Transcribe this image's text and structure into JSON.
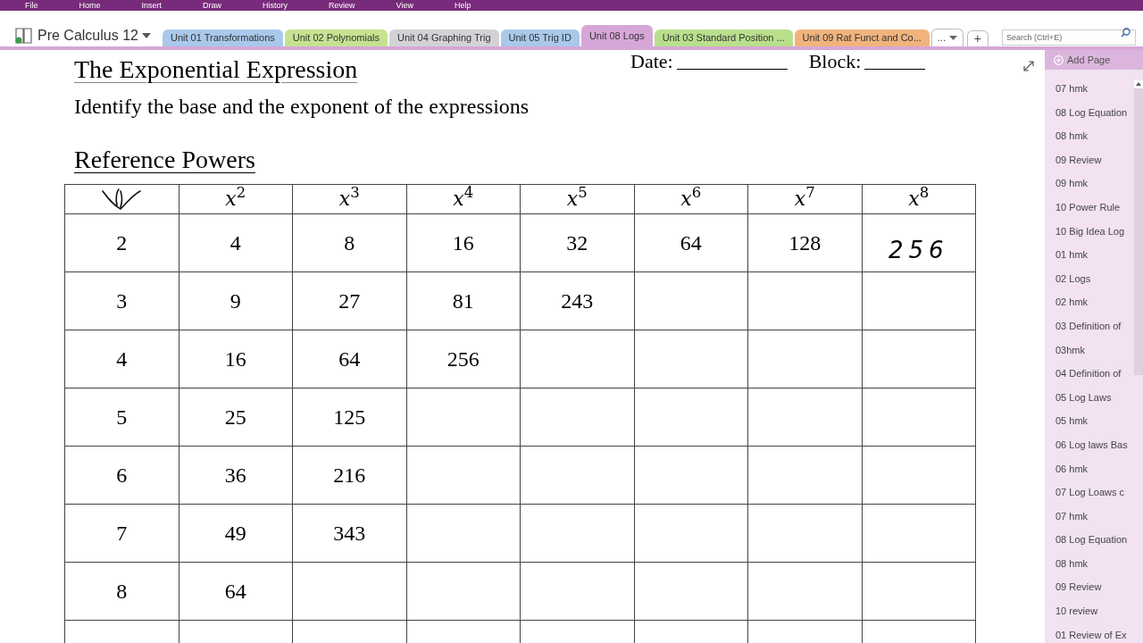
{
  "menu": [
    "File",
    "Home",
    "Insert",
    "Draw",
    "History",
    "Review",
    "View",
    "Help"
  ],
  "notebook": {
    "title": "Pre Calculus 12"
  },
  "tabs": [
    {
      "label": "Unit 01 Transformations",
      "color": "#a9c8ea",
      "selected": false
    },
    {
      "label": "Unit 02 Polynomials",
      "color": "#c6e290",
      "selected": false
    },
    {
      "label": "Unit 04 Graphing Trig",
      "color": "#d2d2d6",
      "selected": false
    },
    {
      "label": "Unit 05 Trig ID",
      "color": "#a9c8ea",
      "selected": false
    },
    {
      "label": "Unit 08 Logs",
      "color": "#d7a6d8",
      "selected": true
    },
    {
      "label": "Unit 03 Standard Position ...",
      "color": "#b9df8c",
      "selected": false
    },
    {
      "label": "Unit 09 Rat Funct and Co...",
      "color": "#f1b37c",
      "selected": false
    }
  ],
  "more_tabs": "...",
  "add_tab": "+",
  "search": {
    "placeholder": "Search (Ctrl+E)"
  },
  "page": {
    "title": "The Exponential Expression",
    "date_label": "Date:",
    "block_label": "Block:",
    "instruction": "Identify the base and the exponent of the expressions",
    "section": "Reference Powers",
    "table": {
      "columns": [
        "",
        "*x*$^{2}$",
        "*x*$^{3}$",
        "*x*$^{4}$",
        "*x*$^{5}$",
        "*x*$^{6}$",
        "*x*$^{7}$",
        "*x*$^{8}$"
      ],
      "rows": [
        [
          {
            "text": "2",
            "kind": "typed"
          },
          {
            "text": "4",
            "kind": "typed"
          },
          {
            "text": "8",
            "kind": "typed"
          },
          {
            "text": "16",
            "kind": "typed"
          },
          {
            "text": "32",
            "kind": "typed"
          },
          {
            "text": "64",
            "kind": "typed"
          },
          {
            "text": "128",
            "kind": "typed"
          },
          {
            "text": "256",
            "kind": "handwritten"
          }
        ],
        [
          {
            "text": "3",
            "kind": "typed"
          },
          {
            "text": "9",
            "kind": "typed"
          },
          {
            "text": "27",
            "kind": "typed"
          },
          {
            "text": "81",
            "kind": "typed"
          },
          {
            "text": "243",
            "kind": "typed"
          }
        ],
        [
          {
            "text": "4",
            "kind": "typed"
          },
          {
            "text": "16",
            "kind": "typed"
          },
          {
            "text": "64",
            "kind": "typed"
          },
          {
            "text": "256",
            "kind": "typed"
          }
        ],
        [
          {
            "text": "5",
            "kind": "typed"
          },
          {
            "text": "25",
            "kind": "typed"
          },
          {
            "text": "125",
            "kind": "typed"
          }
        ],
        [
          {
            "text": "6",
            "kind": "typed"
          },
          {
            "text": "36",
            "kind": "typed"
          },
          {
            "text": "216",
            "kind": "typed"
          }
        ],
        [
          {
            "text": "7",
            "kind": "typed"
          },
          {
            "text": "49",
            "kind": "typed"
          },
          {
            "text": "343",
            "kind": "typed"
          }
        ],
        [
          {
            "text": "8",
            "kind": "typed"
          },
          {
            "text": "64",
            "kind": "typed"
          }
        ],
        []
      ]
    }
  },
  "sidebar": {
    "add_page": "Add Page",
    "pages": [
      "07 hmk",
      "08 Log Equation",
      "08 hmk",
      "09 Review",
      "09 hmk",
      "10 Power Rule",
      "10 Big Idea Log",
      "01 hmk",
      "02 Logs",
      "02 hmk",
      "03 Definition of",
      "03hmk",
      "04 Definition of",
      "05 Log Laws",
      "05 hmk",
      "06 Log laws Bas",
      "06 hmk",
      "07 Log Loaws c",
      "07 hmk",
      "08 Log Equation",
      "08 hmk",
      "09 Review",
      "10 review",
      "01 Review of Ex"
    ]
  }
}
